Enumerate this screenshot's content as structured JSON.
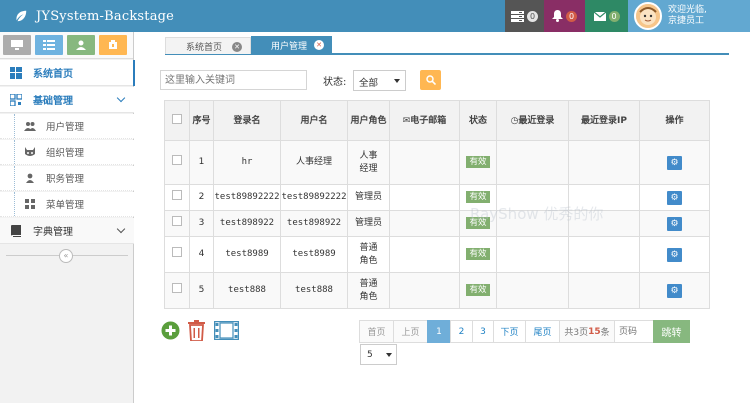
{
  "app": {
    "title": "JYSystem-Backstage"
  },
  "notifications": {
    "tasks_count": "0",
    "alerts_count": "0",
    "messages_count": "0"
  },
  "user": {
    "greeting": "欢迎光临,",
    "name": "京捷员工"
  },
  "sidebar": {
    "items": [
      {
        "label": "系统首页"
      },
      {
        "label": "基础管理"
      },
      {
        "label": "字典管理"
      }
    ],
    "sub_items": [
      {
        "label": "用户管理"
      },
      {
        "label": "组织管理"
      },
      {
        "label": "职务管理"
      },
      {
        "label": "菜单管理"
      }
    ],
    "collapse_glyph": "«"
  },
  "tabs": [
    {
      "label": "系统首页"
    },
    {
      "label": "用户管理"
    }
  ],
  "search": {
    "placeholder": "这里输入关键词",
    "status_label": "状态:",
    "status_value": "全部"
  },
  "table": {
    "headers": {
      "seq": "序号",
      "login": "登录名",
      "username": "用户名",
      "role": "用户角色",
      "email": "电子邮箱",
      "status": "状态",
      "last_login": "最近登录",
      "last_ip": "最近登录IP",
      "ops": "操作"
    },
    "rows": [
      {
        "seq": "1",
        "login": "hr",
        "username": "人事经理",
        "role": "人事经理",
        "status": "有效"
      },
      {
        "seq": "2",
        "login": "test89892222",
        "username": "test89892222",
        "role": "管理员",
        "status": "有效"
      },
      {
        "seq": "3",
        "login": "test898922",
        "username": "test898922",
        "role": "管理员",
        "status": "有效"
      },
      {
        "seq": "4",
        "login": "test8989",
        "username": "test8989",
        "role": "普通角色",
        "status": "有效"
      },
      {
        "seq": "5",
        "login": "test888",
        "username": "test888",
        "role": "普通角色",
        "status": "有效"
      }
    ]
  },
  "pager": {
    "first": "首页",
    "prev": "上页",
    "pages": [
      "1",
      "2",
      "3"
    ],
    "next": "下页",
    "last": "尾页",
    "total_prefix": "共3页",
    "total_count": "15",
    "total_suffix": "条",
    "page_input_placeholder": "页码",
    "jump": "跳转",
    "page_size": "5"
  },
  "watermark": "RayShow 优秀的你",
  "colors": {
    "navbar": "#438eb9",
    "accent": "#2b7dbc",
    "success": "#82af6f",
    "warning": "#ffb752",
    "danger": "#d15b47"
  }
}
